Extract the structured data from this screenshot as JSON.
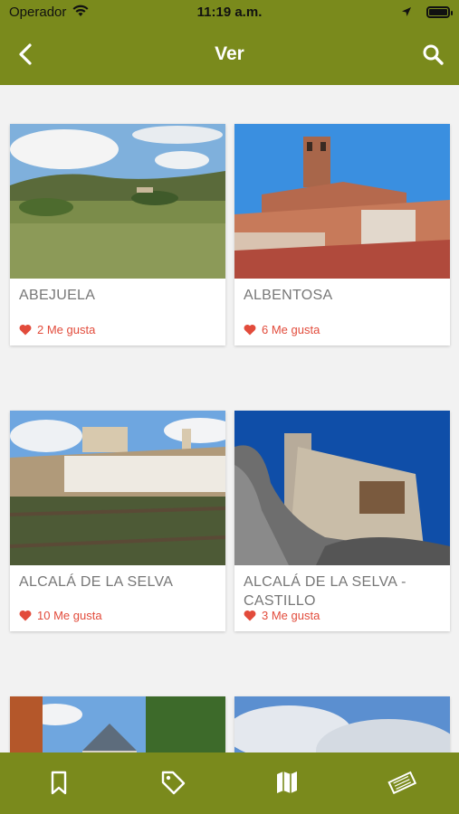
{
  "status": {
    "carrier": "Operador",
    "time": "11:19 a.m."
  },
  "nav": {
    "title": "Ver"
  },
  "cards": [
    {
      "title": "ABEJUELA",
      "likes": "2 Me gusta"
    },
    {
      "title": "ALBENTOSA",
      "likes": "6 Me gusta"
    },
    {
      "title": "ALCALÁ DE LA SELVA",
      "likes": "10 Me gusta"
    },
    {
      "title": "ALCALÁ DE LA SELVA - CASTILLO",
      "likes": "3 Me gusta"
    }
  ],
  "tabs": [
    {
      "icon": "bookmark-icon"
    },
    {
      "icon": "tag-icon"
    },
    {
      "icon": "map-icon"
    },
    {
      "icon": "ticket-icon"
    }
  ],
  "colors": {
    "brand": "#7a8a1c",
    "likes": "#e24b3b",
    "title": "#777777"
  }
}
